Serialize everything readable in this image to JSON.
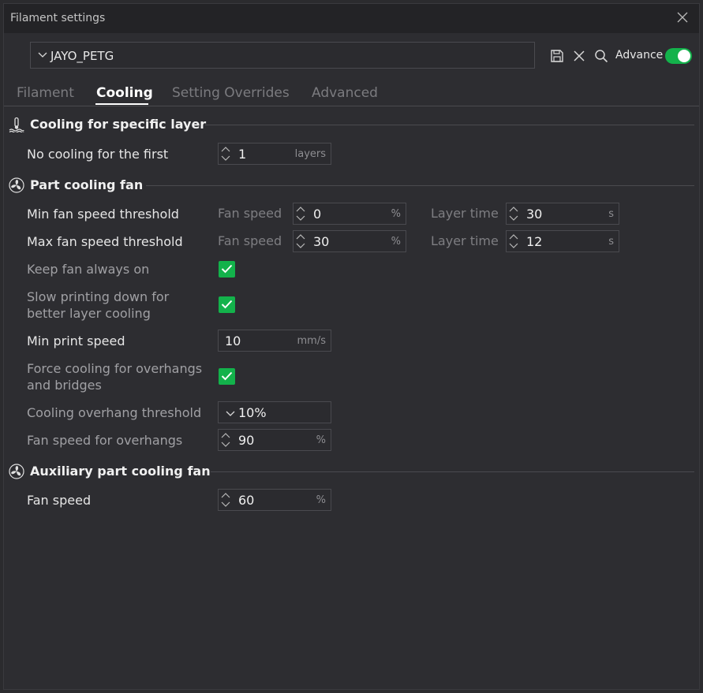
{
  "window": {
    "title": "Filament settings"
  },
  "preset": {
    "name": "JAYO_PETG"
  },
  "toolbar": {
    "advance_label": "Advance",
    "advance_on": true
  },
  "tabs": [
    {
      "label": "Filament",
      "active": false
    },
    {
      "label": "Cooling",
      "active": true
    },
    {
      "label": "Setting Overrides",
      "active": false
    },
    {
      "label": "Advanced",
      "active": false
    }
  ],
  "sections": {
    "specific_layer": {
      "title": "Cooling for specific layer",
      "no_cooling": {
        "label": "No cooling for the first",
        "value": "1",
        "unit": "layers"
      }
    },
    "part_fan": {
      "title": "Part cooling fan",
      "min_threshold": {
        "label": "Min fan speed threshold",
        "fan_label": "Fan speed",
        "fan_value": "0",
        "fan_unit": "%",
        "time_label": "Layer time",
        "time_value": "30",
        "time_unit": "s"
      },
      "max_threshold": {
        "label": "Max fan speed threshold",
        "fan_label": "Fan speed",
        "fan_value": "30",
        "fan_unit": "%",
        "time_label": "Layer time",
        "time_value": "12",
        "time_unit": "s"
      },
      "keep_fan_on": {
        "label": "Keep fan always on",
        "checked": true
      },
      "slow_down": {
        "label_line1": "Slow printing down for",
        "label_line2": "better layer cooling",
        "checked": true
      },
      "min_print_speed": {
        "label": "Min print speed",
        "value": "10",
        "unit": "mm/s"
      },
      "force_cooling": {
        "label_line1": "Force cooling for overhangs",
        "label_line2": "and bridges",
        "checked": true
      },
      "overhang_threshold": {
        "label": "Cooling overhang threshold",
        "value": "10%"
      },
      "overhang_fan": {
        "label": "Fan speed for overhangs",
        "value": "90",
        "unit": "%"
      }
    },
    "aux_fan": {
      "title": "Auxiliary part cooling fan",
      "fan_speed": {
        "label": "Fan speed",
        "value": "60",
        "unit": "%"
      }
    }
  }
}
